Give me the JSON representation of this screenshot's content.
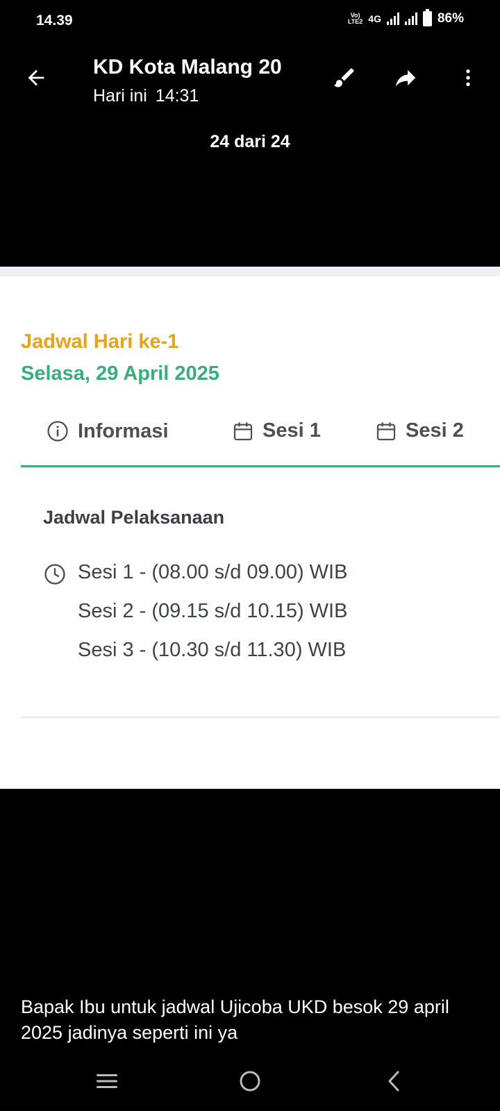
{
  "status_bar": {
    "time": "14.39",
    "volte": "VoLTE2",
    "network": "4G",
    "battery": "86%"
  },
  "app_bar": {
    "title": "KD Kota Malang 20",
    "subtitle_day": "Hari ini",
    "subtitle_time": "14:31",
    "counter": "24 dari 24",
    "icons": [
      "back-arrow-icon",
      "brush-icon",
      "share-icon",
      "more-vert-icon"
    ]
  },
  "schedule": {
    "day": "Jadwal Hari ke-1",
    "date": "Selasa, 29 April 2025",
    "tabs": [
      {
        "label": "Informasi",
        "icon": "info-icon"
      },
      {
        "label": "Sesi 1",
        "icon": "calendar-icon"
      },
      {
        "label": "Sesi 2",
        "icon": "calendar-icon"
      }
    ],
    "section_title": "Jadwal Pelaksanaan",
    "sessions": [
      "Sesi 1 - (08.00 s/d 09.00) WIB",
      "Sesi 2 - (09.15 s/d 10.15) WIB",
      "Sesi 3 - (10.30 s/d 11.30) WIB"
    ],
    "colors": {
      "day": "#e8a317",
      "date": "#35b07a",
      "tab_underline": "#35b07a"
    }
  },
  "caption": "Bapak Ibu untuk jadwal Ujicoba UKD besok 29 april 2025 jadinya seperti ini ya",
  "nav_bar": {
    "icons": [
      "recents-icon",
      "home-icon",
      "back-icon"
    ]
  }
}
